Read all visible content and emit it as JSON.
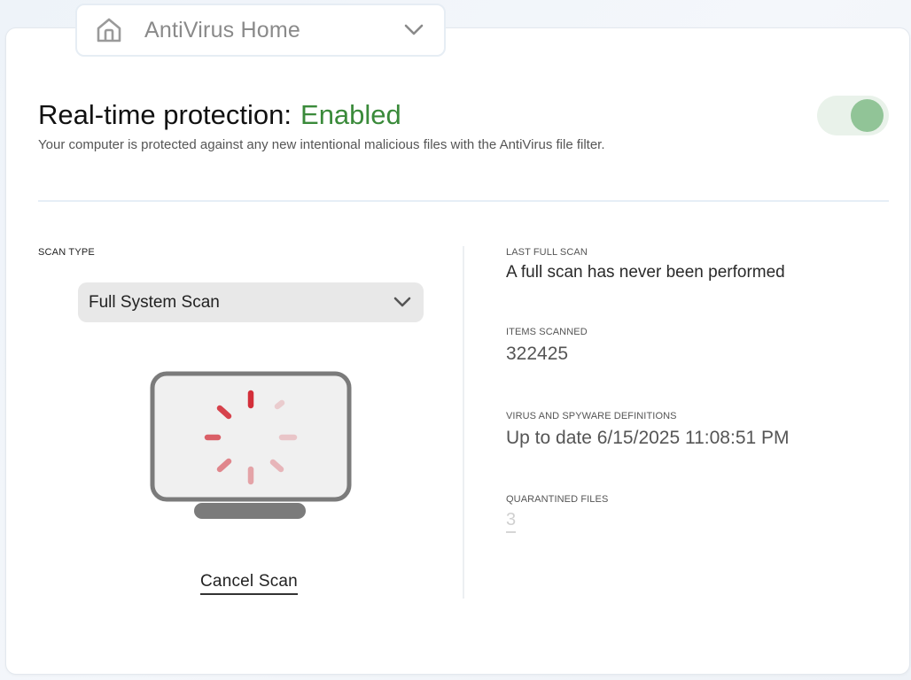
{
  "nav": {
    "icon": "home-icon",
    "label": "AntiVirus Home",
    "chevron": "chevron-down-icon"
  },
  "protection": {
    "title": "Real-time protection:",
    "status": "Enabled",
    "description": "Your computer is protected against any new intentional malicious files with the AntiVirus file filter.",
    "toggle_on": true
  },
  "scan": {
    "type_label": "SCAN TYPE",
    "selected": "Full System Scan",
    "cancel_label": "Cancel Scan"
  },
  "stats": {
    "last_full_scan_label": "LAST FULL SCAN",
    "last_full_scan_value": "A full scan has never been performed",
    "items_scanned_label": "ITEMS SCANNED",
    "items_scanned_value": "322425",
    "definitions_label": "VIRUS AND SPYWARE DEFINITIONS",
    "definitions_value": "Up to date 6/15/2025 11:08:51 PM",
    "quarantined_label": "QUARANTINED FILES",
    "quarantined_value": "3"
  },
  "colors": {
    "enabled": "#3a8a3a",
    "toggle_track": "#e9f2ea",
    "toggle_knob": "#91c497",
    "spinner": "#d32f3a"
  }
}
